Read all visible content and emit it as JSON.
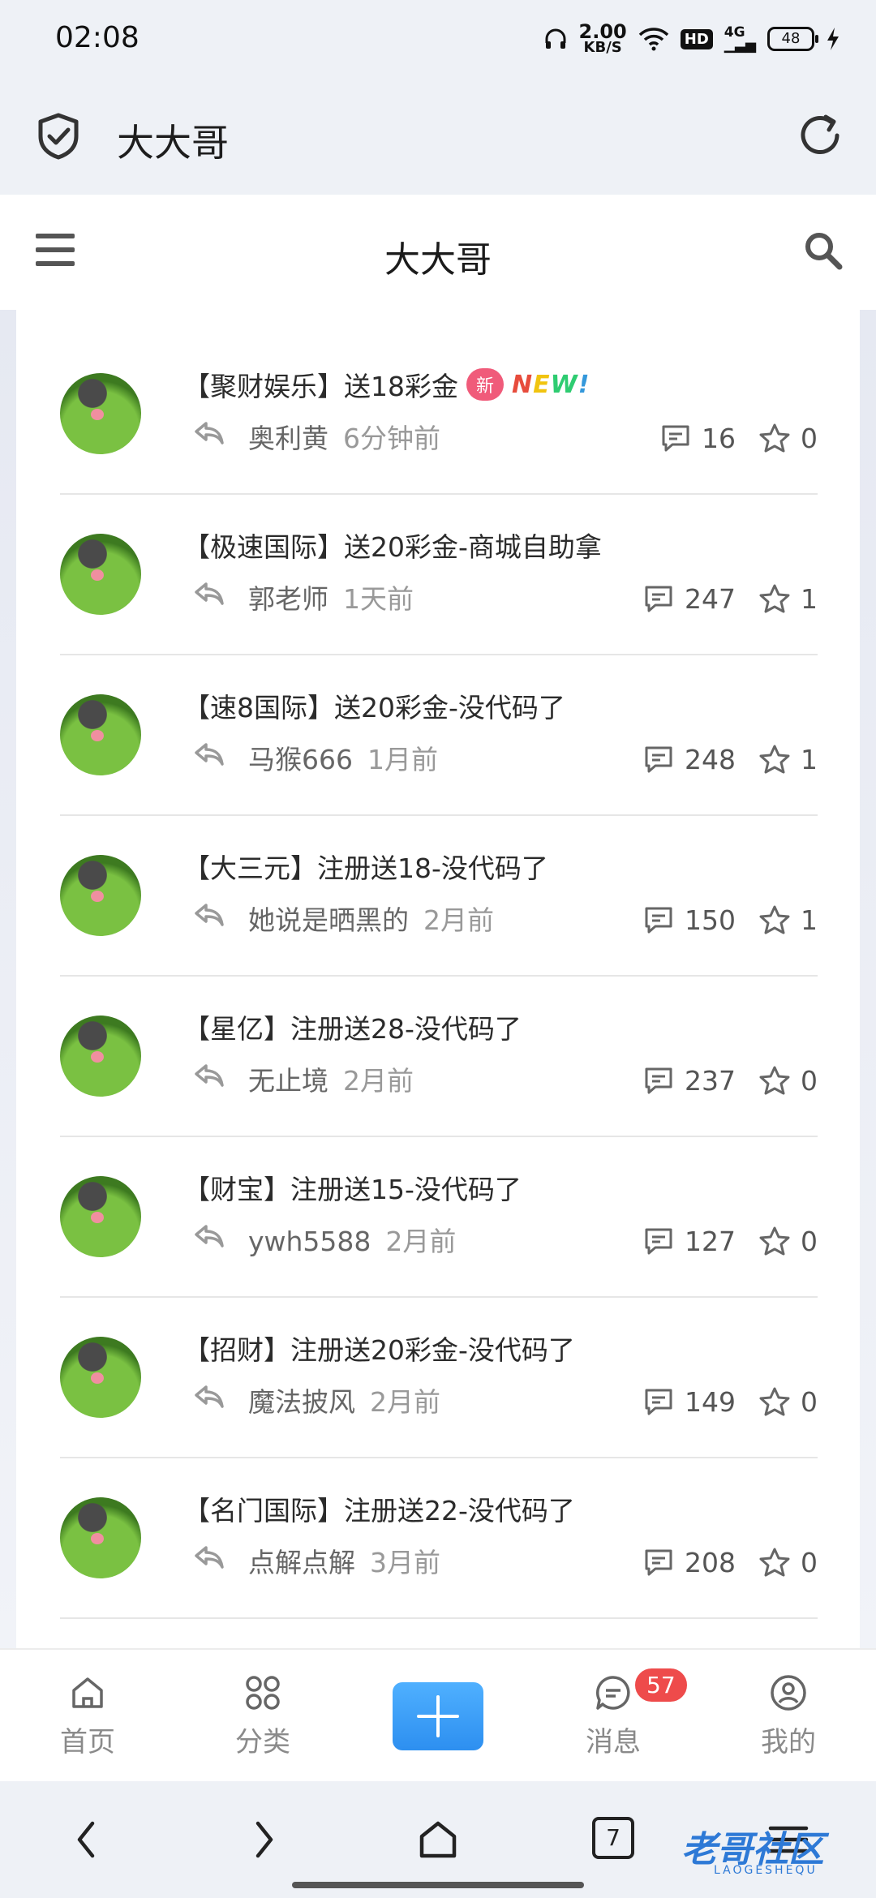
{
  "status": {
    "time": "02:08",
    "speed_value": "2.00",
    "speed_unit": "KB/S",
    "hd": "HD",
    "network": "4G",
    "battery": "48"
  },
  "browser": {
    "title": "大大哥"
  },
  "site": {
    "title": "大大哥"
  },
  "posts": [
    {
      "title": "【聚财娱乐】送18彩金",
      "badge": "新",
      "new_label": [
        "N",
        "E",
        "W",
        "!"
      ],
      "author": "奥利黄",
      "time": "6分钟前",
      "comments": "16",
      "stars": "0"
    },
    {
      "title": "【极速国际】送20彩金-商城自助拿",
      "author": "郭老师",
      "time": "1天前",
      "comments": "247",
      "stars": "1"
    },
    {
      "title": "【速8国际】送20彩金-没代码了",
      "author": "马猴666",
      "time": "1月前",
      "comments": "248",
      "stars": "1"
    },
    {
      "title": "【大三元】注册送18-没代码了",
      "author": "她说是晒黑的",
      "time": "2月前",
      "comments": "150",
      "stars": "1"
    },
    {
      "title": "【星亿】注册送28-没代码了",
      "author": "无止境",
      "time": "2月前",
      "comments": "237",
      "stars": "0"
    },
    {
      "title": "【财宝】注册送15-没代码了",
      "author": "ywh5588",
      "time": "2月前",
      "comments": "127",
      "stars": "0"
    },
    {
      "title": "【招财】注册送20彩金-没代码了",
      "author": "魔法披风",
      "time": "2月前",
      "comments": "149",
      "stars": "0"
    },
    {
      "title": "【名门国际】注册送22-没代码了",
      "author": "点解点解",
      "time": "3月前",
      "comments": "208",
      "stars": "0"
    }
  ],
  "tabs": {
    "home": "首页",
    "category": "分类",
    "messages": "消息",
    "messages_badge": "57",
    "mine": "我的"
  },
  "nav": {
    "tab_count": "7"
  },
  "watermark": {
    "title": "老哥社区",
    "subtitle": "LAOGESHEQU"
  },
  "colors": {
    "accent": "#2d8ff0",
    "badge_red": "#ee4b4b",
    "new_pink": "#f05b7a"
  }
}
